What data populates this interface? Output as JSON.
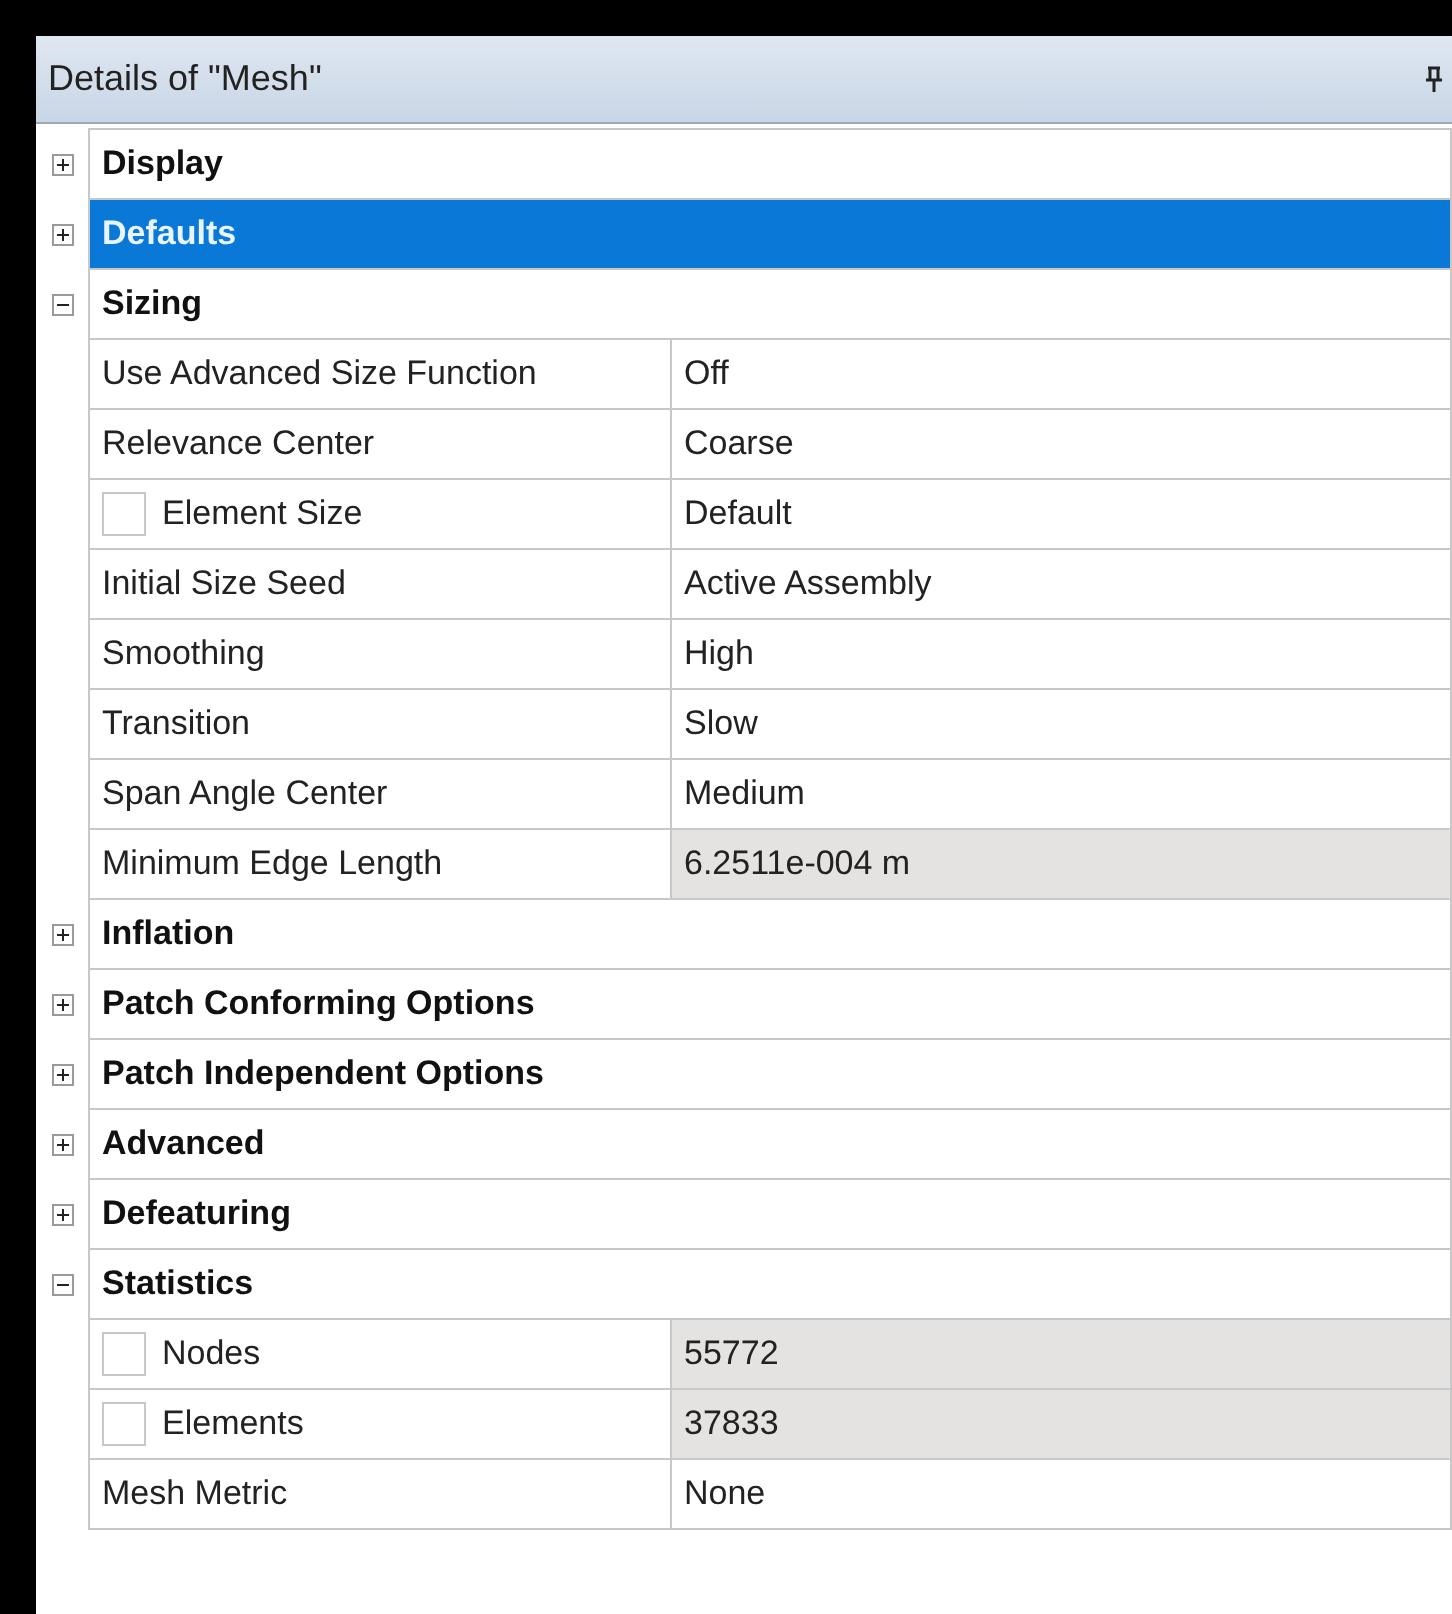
{
  "panel": {
    "title": "Details of \"Mesh\""
  },
  "groups": [
    {
      "label": "Display",
      "expanded": false,
      "selected": false
    },
    {
      "label": "Defaults",
      "expanded": false,
      "selected": true
    },
    {
      "label": "Sizing",
      "expanded": true,
      "selected": false,
      "properties": [
        {
          "kind": "plain",
          "name": "Use Advanced Size Function",
          "value": "Off",
          "readonly": false
        },
        {
          "kind": "plain",
          "name": "Relevance Center",
          "value": "Coarse",
          "readonly": false
        },
        {
          "kind": "checkbox",
          "checked": false,
          "name": "Element Size",
          "value": "Default",
          "readonly": false
        },
        {
          "kind": "plain",
          "name": "Initial Size Seed",
          "value": "Active Assembly",
          "readonly": false
        },
        {
          "kind": "plain",
          "name": "Smoothing",
          "value": "High",
          "readonly": false
        },
        {
          "kind": "plain",
          "name": "Transition",
          "value": "Slow",
          "readonly": false
        },
        {
          "kind": "plain",
          "name": "Span Angle Center",
          "value": "Medium",
          "readonly": false
        },
        {
          "kind": "plain",
          "name": "Minimum Edge Length",
          "value": "6.2511e-004 m",
          "readonly": true
        }
      ]
    },
    {
      "label": "Inflation",
      "expanded": false,
      "selected": false
    },
    {
      "label": "Patch Conforming Options",
      "expanded": false,
      "selected": false
    },
    {
      "label": "Patch Independent Options",
      "expanded": false,
      "selected": false
    },
    {
      "label": "Advanced",
      "expanded": false,
      "selected": false
    },
    {
      "label": "Defeaturing",
      "expanded": false,
      "selected": false
    },
    {
      "label": "Statistics",
      "expanded": true,
      "selected": false,
      "properties": [
        {
          "kind": "checkbox",
          "checked": false,
          "name": "Nodes",
          "value": "55772",
          "readonly": true
        },
        {
          "kind": "checkbox",
          "checked": false,
          "name": "Elements",
          "value": "37833",
          "readonly": true
        },
        {
          "kind": "plain",
          "name": "Mesh Metric",
          "value": "None",
          "readonly": false
        }
      ]
    }
  ]
}
